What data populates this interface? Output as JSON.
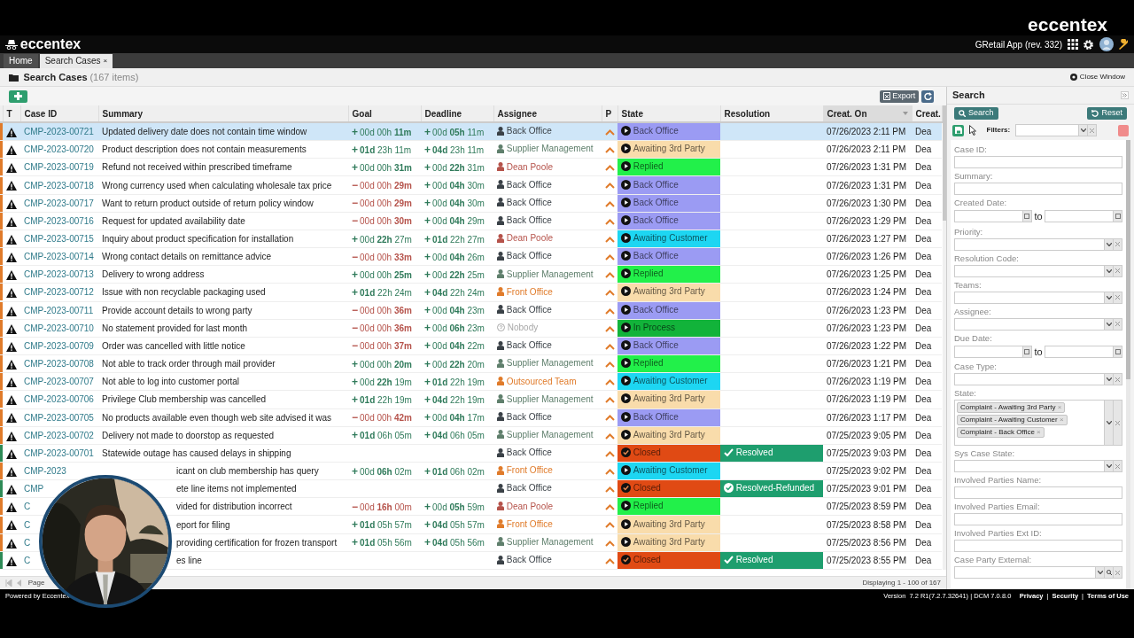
{
  "video_logo": "eccentex",
  "app_bar": {
    "logo": "eccentex",
    "app_name": "GRetail App (rev. 332)"
  },
  "tabs": [
    {
      "label": "Home",
      "selected": false
    },
    {
      "label": "Search Cases",
      "selected": true,
      "close": "×"
    }
  ],
  "page_title": {
    "title": "Search Cases",
    "count": "(167 items)",
    "close": "Close Window"
  },
  "toolbar": {
    "export": "Export"
  },
  "columns": [
    {
      "label": "T"
    },
    {
      "label": "Case ID"
    },
    {
      "label": "Summary"
    },
    {
      "label": "Goal"
    },
    {
      "label": "Deadline"
    },
    {
      "label": "Assignee"
    },
    {
      "label": "P"
    },
    {
      "label": "State"
    },
    {
      "label": "Resolution"
    },
    {
      "label": "Creat. On",
      "sorted": true
    },
    {
      "label": "Creat."
    }
  ],
  "rows": [
    {
      "id": "CMP-2023-00721",
      "summary": "Updated delivery date does not contain time window",
      "goal": {
        "sign": "+",
        "text": "00d 00h **11m**",
        "late": false
      },
      "deadline": {
        "sign": "+",
        "text": "00d **05h** 11m",
        "late": false
      },
      "assignee": {
        "name": "Back Office",
        "color": "#3a4147",
        "kind": "person"
      },
      "state": {
        "label": "Back Office",
        "color": "#9b9bf3",
        "kind": "open"
      },
      "created": "07/26/2023 2:11 PM",
      "creator": "Dea",
      "color": "#e07b2a",
      "selected": true
    },
    {
      "id": "CMP-2023-00720",
      "summary": "Product description does not contain measurements",
      "goal": {
        "sign": "+",
        "text": "**01d** 23h 11m",
        "late": false
      },
      "deadline": {
        "sign": "+",
        "text": "**04d** 23h 11m",
        "late": false
      },
      "assignee": {
        "name": "Supplier Management",
        "color": "#5f7f6c",
        "kind": "person"
      },
      "state": {
        "label": "Awaiting 3rd Party",
        "color": "#f9dcab",
        "kind": "open"
      },
      "created": "07/26/2023 2:11 PM",
      "creator": "Dea",
      "color": "#e07b2a",
      "selected": false
    },
    {
      "id": "CMP-2023-00719",
      "summary": "Refund not received within prescribed timeframe",
      "goal": {
        "sign": "+",
        "text": "00d 00h **31m**",
        "late": false
      },
      "deadline": {
        "sign": "+",
        "text": "00d **22h** 31m",
        "late": false
      },
      "assignee": {
        "name": "Dean Poole",
        "color": "#b5524a",
        "kind": "person"
      },
      "state": {
        "label": "Replied",
        "color": "#22f04a",
        "kind": "open"
      },
      "created": "07/26/2023 1:31 PM",
      "creator": "Dea",
      "color": "#e07b2a",
      "selected": false
    },
    {
      "id": "CMP-2023-00718",
      "summary": "Wrong currency used when calculating wholesale tax price",
      "goal": {
        "sign": "−",
        "text": "00d 00h **29m**",
        "late": true
      },
      "deadline": {
        "sign": "+",
        "text": "00d **04h** 30m",
        "late": false
      },
      "assignee": {
        "name": "Back Office",
        "color": "#3a4147",
        "kind": "person"
      },
      "state": {
        "label": "Back Office",
        "color": "#9b9bf3",
        "kind": "open"
      },
      "created": "07/26/2023 1:31 PM",
      "creator": "Dea",
      "color": "#e07b2a",
      "selected": false
    },
    {
      "id": "CMP-2023-00717",
      "summary": "Want to return product outside of return policy window",
      "goal": {
        "sign": "−",
        "text": "00d 00h **29m**",
        "late": true
      },
      "deadline": {
        "sign": "+",
        "text": "00d **04h** 30m",
        "late": false
      },
      "assignee": {
        "name": "Back Office",
        "color": "#3a4147",
        "kind": "person"
      },
      "state": {
        "label": "Back Office",
        "color": "#9b9bf3",
        "kind": "open"
      },
      "created": "07/26/2023 1:30 PM",
      "creator": "Dea",
      "color": "#e07b2a",
      "selected": false
    },
    {
      "id": "CMP-2023-00716",
      "summary": "Request for updated availability date",
      "goal": {
        "sign": "−",
        "text": "00d 00h **30m**",
        "late": true
      },
      "deadline": {
        "sign": "+",
        "text": "00d **04h** 29m",
        "late": false
      },
      "assignee": {
        "name": "Back Office",
        "color": "#3a4147",
        "kind": "person"
      },
      "state": {
        "label": "Back Office",
        "color": "#9b9bf3",
        "kind": "open"
      },
      "created": "07/26/2023 1:29 PM",
      "creator": "Dea",
      "color": "#e07b2a",
      "selected": false
    },
    {
      "id": "CMP-2023-00715",
      "summary": "Inquiry about product specification for installation",
      "goal": {
        "sign": "+",
        "text": "00d **22h** 27m",
        "late": false
      },
      "deadline": {
        "sign": "+",
        "text": "**01d** 22h 27m",
        "late": false
      },
      "assignee": {
        "name": "Dean Poole",
        "color": "#b5524a",
        "kind": "person"
      },
      "state": {
        "label": "Awaiting Customer",
        "color": "#1dd6f2",
        "kind": "open"
      },
      "created": "07/26/2023 1:27 PM",
      "creator": "Dea",
      "color": "#e07b2a",
      "selected": false
    },
    {
      "id": "CMP-2023-00714",
      "summary": "Wrong contact details on remittance advice",
      "goal": {
        "sign": "−",
        "text": "00d 00h **33m**",
        "late": true
      },
      "deadline": {
        "sign": "+",
        "text": "00d **04h** 26m",
        "late": false
      },
      "assignee": {
        "name": "Back Office",
        "color": "#3a4147",
        "kind": "person"
      },
      "state": {
        "label": "Back Office",
        "color": "#9b9bf3",
        "kind": "open"
      },
      "created": "07/26/2023 1:26 PM",
      "creator": "Dea",
      "color": "#e07b2a",
      "selected": false
    },
    {
      "id": "CMP-2023-00713",
      "summary": "Delivery to wrong address",
      "goal": {
        "sign": "+",
        "text": "00d 00h **25m**",
        "late": false
      },
      "deadline": {
        "sign": "+",
        "text": "00d **22h** 25m",
        "late": false
      },
      "assignee": {
        "name": "Supplier Management",
        "color": "#5f7f6c",
        "kind": "person"
      },
      "state": {
        "label": "Replied",
        "color": "#22f04a",
        "kind": "open"
      },
      "created": "07/26/2023 1:25 PM",
      "creator": "Dea",
      "color": "#e07b2a",
      "selected": false
    },
    {
      "id": "CMP-2023-00712",
      "summary": "Issue with non recyclable packaging used",
      "goal": {
        "sign": "+",
        "text": "**01d** 22h 24m",
        "late": false
      },
      "deadline": {
        "sign": "+",
        "text": "**04d** 22h 24m",
        "late": false
      },
      "assignee": {
        "name": "Front Office",
        "color": "#e07b2a",
        "kind": "person"
      },
      "state": {
        "label": "Awaiting 3rd Party",
        "color": "#f9dcab",
        "kind": "open"
      },
      "created": "07/26/2023 1:24 PM",
      "creator": "Dea",
      "color": "#e07b2a",
      "selected": false
    },
    {
      "id": "CMP-2023-00711",
      "summary": "Provide account details to wrong party",
      "goal": {
        "sign": "−",
        "text": "00d 00h **36m**",
        "late": true
      },
      "deadline": {
        "sign": "+",
        "text": "00d **04h** 23m",
        "late": false
      },
      "assignee": {
        "name": "Back Office",
        "color": "#3a4147",
        "kind": "person"
      },
      "state": {
        "label": "Back Office",
        "color": "#9b9bf3",
        "kind": "open"
      },
      "created": "07/26/2023 1:23 PM",
      "creator": "Dea",
      "color": "#e07b2a",
      "selected": false
    },
    {
      "id": "CMP-2023-00710",
      "summary": "No statement provided for last month",
      "goal": {
        "sign": "−",
        "text": "00d 00h **36m**",
        "late": true
      },
      "deadline": {
        "sign": "+",
        "text": "00d **06h** 23m",
        "late": false
      },
      "assignee": {
        "name": "Nobody",
        "color": "#a8a8a8",
        "kind": "unassigned"
      },
      "state": {
        "label": "In Process",
        "color": "#12b33a",
        "kind": "open"
      },
      "created": "07/26/2023 1:23 PM",
      "creator": "Dea",
      "color": "#e07b2a",
      "selected": false
    },
    {
      "id": "CMP-2023-00709",
      "summary": "Order was cancelled with little notice",
      "goal": {
        "sign": "−",
        "text": "00d 00h **37m**",
        "late": true
      },
      "deadline": {
        "sign": "+",
        "text": "00d **04h** 22m",
        "late": false
      },
      "assignee": {
        "name": "Back Office",
        "color": "#3a4147",
        "kind": "person"
      },
      "state": {
        "label": "Back Office",
        "color": "#9b9bf3",
        "kind": "open"
      },
      "created": "07/26/2023 1:22 PM",
      "creator": "Dea",
      "color": "#e07b2a",
      "selected": false
    },
    {
      "id": "CMP-2023-00708",
      "summary": "Not able to track order through mail provider",
      "goal": {
        "sign": "+",
        "text": "00d 00h **20m**",
        "late": false
      },
      "deadline": {
        "sign": "+",
        "text": "00d **22h** 20m",
        "late": false
      },
      "assignee": {
        "name": "Supplier Management",
        "color": "#5f7f6c",
        "kind": "person"
      },
      "state": {
        "label": "Replied",
        "color": "#22f04a",
        "kind": "open"
      },
      "created": "07/26/2023 1:21 PM",
      "creator": "Dea",
      "color": "#e07b2a",
      "selected": false
    },
    {
      "id": "CMP-2023-00707",
      "summary": "Not able to log into customer portal",
      "goal": {
        "sign": "+",
        "text": "00d **22h** 19m",
        "late": false
      },
      "deadline": {
        "sign": "+",
        "text": "**01d** 22h 19m",
        "late": false
      },
      "assignee": {
        "name": "Outsourced Team",
        "color": "#e07b2a",
        "kind": "person"
      },
      "state": {
        "label": "Awaiting Customer",
        "color": "#1dd6f2",
        "kind": "open"
      },
      "created": "07/26/2023 1:19 PM",
      "creator": "Dea",
      "color": "#e07b2a",
      "selected": false
    },
    {
      "id": "CMP-2023-00706",
      "summary": "Privilege Club membership was cancelled",
      "goal": {
        "sign": "+",
        "text": "**01d** 22h 19m",
        "late": false
      },
      "deadline": {
        "sign": "+",
        "text": "**04d** 22h 19m",
        "late": false
      },
      "assignee": {
        "name": "Supplier Management",
        "color": "#5f7f6c",
        "kind": "person"
      },
      "state": {
        "label": "Awaiting 3rd Party",
        "color": "#f9dcab",
        "kind": "open"
      },
      "created": "07/26/2023 1:19 PM",
      "creator": "Dea",
      "color": "#e07b2a",
      "selected": false
    },
    {
      "id": "CMP-2023-00705",
      "summary": "No products available even though web site advised it was",
      "goal": {
        "sign": "−",
        "text": "00d 00h **42m**",
        "late": true
      },
      "deadline": {
        "sign": "+",
        "text": "00d **04h** 17m",
        "late": false
      },
      "assignee": {
        "name": "Back Office",
        "color": "#3a4147",
        "kind": "person"
      },
      "state": {
        "label": "Back Office",
        "color": "#9b9bf3",
        "kind": "open"
      },
      "created": "07/26/2023 1:17 PM",
      "creator": "Dea",
      "color": "#e07b2a",
      "selected": false
    },
    {
      "id": "CMP-2023-00702",
      "summary": "Delivery not made to doorstop as requested",
      "goal": {
        "sign": "+",
        "text": "**01d** 06h 05m",
        "late": false
      },
      "deadline": {
        "sign": "+",
        "text": "**04d** 06h 05m",
        "late": false
      },
      "assignee": {
        "name": "Supplier Management",
        "color": "#5f7f6c",
        "kind": "person"
      },
      "state": {
        "label": "Awaiting 3rd Party",
        "color": "#f9dcab",
        "kind": "open"
      },
      "created": "07/25/2023 9:05 PM",
      "creator": "Dea",
      "color": "#e07b2a",
      "selected": false
    },
    {
      "id": "CMP-2023-00701",
      "summary": "Statewide outage has caused delays in shipping",
      "assignee": {
        "name": "Back Office",
        "color": "#3a4147",
        "kind": "person"
      },
      "state": {
        "label": "Closed",
        "color": "#e04a14",
        "kind": "closed"
      },
      "resolution": {
        "label": "Resolved",
        "color": "#1e9e6e",
        "kind": "resolved"
      },
      "created": "07/25/2023 9:03 PM",
      "creator": "Dea",
      "color": "#2e8b57",
      "selected": false
    },
    {
      "id": "CMP-2023",
      "summary": "icant on club membership has query",
      "partly_hidden": true,
      "goal": {
        "sign": "+",
        "text": "00d **06h** 02m",
        "late": false
      },
      "deadline": {
        "sign": "+",
        "text": "**01d** 06h 02m",
        "late": false
      },
      "assignee": {
        "name": "Front Office",
        "color": "#e07b2a",
        "kind": "person"
      },
      "state": {
        "label": "Awaiting Customer",
        "color": "#1dd6f2",
        "kind": "open"
      },
      "created": "07/25/2023 9:02 PM",
      "creator": "Dea",
      "color": "#e07b2a",
      "selected": false
    },
    {
      "id": "CMP",
      "summary": "ete line items not implemented",
      "partly_hidden": true,
      "assignee": {
        "name": "Back Office",
        "color": "#3a4147",
        "kind": "person"
      },
      "state": {
        "label": "Closed",
        "color": "#e04a14",
        "kind": "closed"
      },
      "resolution": {
        "label": "Resolved-Refunded",
        "color": "#1e9e6e",
        "kind": "refunded"
      },
      "created": "07/25/2023 9:01 PM",
      "creator": "Dea",
      "color": "#2e8b57",
      "selected": false
    },
    {
      "id": "C",
      "summary": "vided for distribution incorrect",
      "partly_hidden": true,
      "goal": {
        "sign": "−",
        "text": "00d **16h** 00m",
        "late": true
      },
      "deadline": {
        "sign": "+",
        "text": "00d **05h** 59m",
        "late": false
      },
      "assignee": {
        "name": "Dean Poole",
        "color": "#b5524a",
        "kind": "person"
      },
      "state": {
        "label": "Replied",
        "color": "#22f04a",
        "kind": "open"
      },
      "created": "07/25/2023 8:59 PM",
      "creator": "Dea",
      "color": "#e07b2a",
      "selected": false
    },
    {
      "id": "C",
      "summary": "eport for filing",
      "partly_hidden": true,
      "goal": {
        "sign": "+",
        "text": "**01d** 05h 57m",
        "late": false
      },
      "deadline": {
        "sign": "+",
        "text": "**04d** 05h 57m",
        "late": false
      },
      "assignee": {
        "name": "Front Office",
        "color": "#e07b2a",
        "kind": "person"
      },
      "state": {
        "label": "Awaiting 3rd Party",
        "color": "#f9dcab",
        "kind": "open"
      },
      "created": "07/25/2023 8:58 PM",
      "creator": "Dea",
      "color": "#e07b2a",
      "selected": false
    },
    {
      "id": "C",
      "summary": "providing certification for frozen transport",
      "partly_hidden": true,
      "goal": {
        "sign": "+",
        "text": "**01d** 05h 56m",
        "late": false
      },
      "deadline": {
        "sign": "+",
        "text": "**04d** 05h 56m",
        "late": false
      },
      "assignee": {
        "name": "Supplier Management",
        "color": "#5f7f6c",
        "kind": "person"
      },
      "state": {
        "label": "Awaiting 3rd Party",
        "color": "#f9dcab",
        "kind": "open"
      },
      "created": "07/25/2023 8:56 PM",
      "creator": "Dea",
      "color": "#e07b2a",
      "selected": false
    },
    {
      "id": "C",
      "summary": "es line",
      "partly_hidden": true,
      "assignee": {
        "name": "Back Office",
        "color": "#3a4147",
        "kind": "person"
      },
      "state": {
        "label": "Closed",
        "color": "#e04a14",
        "kind": "closed"
      },
      "resolution": {
        "label": "Resolved",
        "color": "#1e9e6e",
        "kind": "resolved"
      },
      "created": "07/25/2023 8:55 PM",
      "creator": "Dea",
      "color": "#2e8b57",
      "selected": false
    }
  ],
  "pager": {
    "page_label": "Page",
    "displaying": "Displaying 1 - 100 of 167"
  },
  "search_panel": {
    "title": "Search",
    "search_button": "Search",
    "reset_button": "Reset",
    "filters_label": "Filters:",
    "fields": [
      {
        "label": "Case ID:",
        "kind": "text"
      },
      {
        "label": "Summary:",
        "kind": "text"
      },
      {
        "label": "Created Date:",
        "kind": "daterange",
        "to": "to"
      },
      {
        "label": "Priority:",
        "kind": "select"
      },
      {
        "label": "Resolution Code:",
        "kind": "select"
      },
      {
        "label": "Teams:",
        "kind": "select"
      },
      {
        "label": "Assignee:",
        "kind": "select"
      },
      {
        "label": "Due Date:",
        "kind": "daterange",
        "to": "to"
      },
      {
        "label": "Case Type:",
        "kind": "select"
      },
      {
        "label": "State:",
        "kind": "multiselect",
        "tags": [
          {
            "label": "Complaint - Awaiting 3rd Party",
            "remove": "×"
          },
          {
            "label": "Complaint - Awaiting Customer",
            "remove": "×"
          },
          {
            "label": "Complaint - Back Office",
            "remove": "×"
          }
        ]
      },
      {
        "label": "Sys Case State:",
        "kind": "select"
      },
      {
        "label": "Involved Parties Name:",
        "kind": "text"
      },
      {
        "label": "Involved Parties Email:",
        "kind": "text"
      },
      {
        "label": "Involved Parties Ext ID:",
        "kind": "text"
      },
      {
        "label": "Case Party External:",
        "kind": "lookup"
      }
    ]
  },
  "footer": {
    "powered": "Powered by Eccentex",
    "version_label": "Version",
    "version": "7.2 R1(7.2.7.32641) | DCM 7.0.8.0",
    "links": [
      "Privacy",
      "Security",
      "Terms of Use"
    ],
    "separator": "|"
  }
}
